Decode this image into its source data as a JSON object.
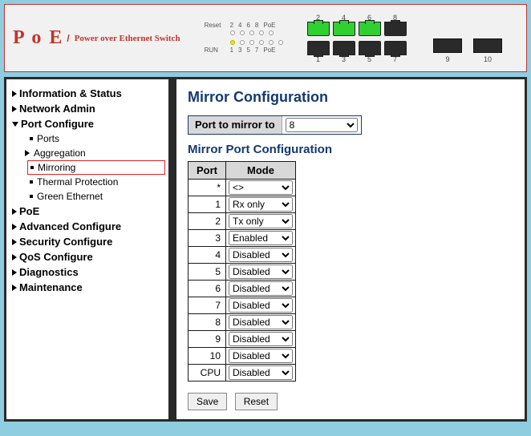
{
  "header": {
    "logo": "P o E",
    "caption": "Power over Ethernet Switch",
    "led_labels_top": [
      "2",
      "4",
      "6",
      "8",
      "PoE"
    ],
    "led_reset": "Reset",
    "led_labels_bot": [
      "1",
      "3",
      "5",
      "7",
      "PoE"
    ],
    "led_run": "RUN",
    "top_ports": [
      "2",
      "4",
      "6",
      "8"
    ],
    "bot_ports": [
      "1",
      "3",
      "5",
      "7"
    ],
    "uplink_labels": [
      "9",
      "10"
    ]
  },
  "nav": {
    "info_status": "Information & Status",
    "network_admin": "Network Admin",
    "port_configure": "Port Configure",
    "ports": "Ports",
    "aggregation": "Aggregation",
    "mirroring": "Mirroring",
    "thermal": "Thermal Protection",
    "green": "Green Ethernet",
    "poe": "PoE",
    "adv": "Advanced Configure",
    "sec": "Security Configure",
    "qos": "QoS Configure",
    "diag": "Diagnostics",
    "maint": "Maintenance"
  },
  "page": {
    "title": "Mirror Configuration",
    "port_to_mirror_label": "Port to mirror to",
    "port_to_mirror_value": "8",
    "section_title": "Mirror Port Configuration",
    "col_port": "Port",
    "col_mode": "Mode",
    "rows": [
      {
        "port": "*",
        "mode": "<>"
      },
      {
        "port": "1",
        "mode": "Rx only"
      },
      {
        "port": "2",
        "mode": "Tx only"
      },
      {
        "port": "3",
        "mode": "Enabled"
      },
      {
        "port": "4",
        "mode": "Disabled"
      },
      {
        "port": "5",
        "mode": "Disabled"
      },
      {
        "port": "6",
        "mode": "Disabled"
      },
      {
        "port": "7",
        "mode": "Disabled"
      },
      {
        "port": "8",
        "mode": "Disabled"
      },
      {
        "port": "9",
        "mode": "Disabled"
      },
      {
        "port": "10",
        "mode": "Disabled"
      },
      {
        "port": "CPU",
        "mode": "Disabled"
      }
    ],
    "save_label": "Save",
    "reset_label": "Reset"
  }
}
